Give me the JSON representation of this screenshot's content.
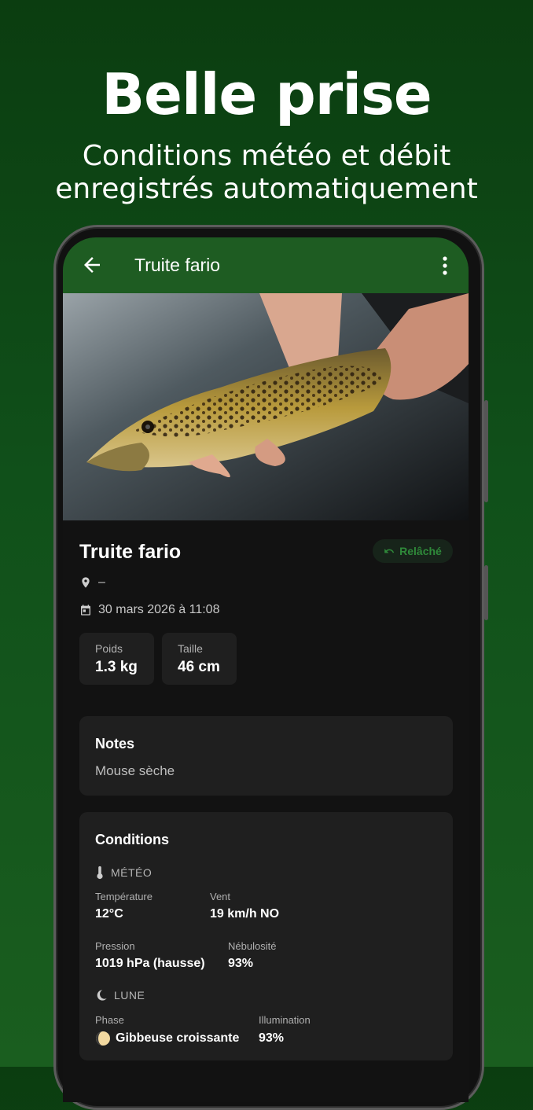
{
  "promo": {
    "title": "Belle prise",
    "subtitle_line1": "Conditions météo et débit",
    "subtitle_line2": "enregistrés automatiquement"
  },
  "appbar": {
    "title": "Truite fario",
    "back_icon": "arrow-back-icon",
    "more_icon": "more-vert-icon"
  },
  "catch": {
    "name": "Truite fario",
    "status_badge": "Relâché",
    "location": "–",
    "datetime": "30 mars 2026 à 11:08",
    "stats": [
      {
        "label": "Poids",
        "value": "1.3 kg"
      },
      {
        "label": "Taille",
        "value": "46 cm"
      }
    ]
  },
  "notes": {
    "title": "Notes",
    "text": "Mouse sèche"
  },
  "conditions": {
    "title": "Conditions",
    "weather": {
      "heading": "MÉTÉO",
      "temperature_label": "Température",
      "temperature_value": "12°C",
      "wind_label": "Vent",
      "wind_value": "19 km/h NO",
      "pressure_label": "Pression",
      "pressure_value": "1019 hPa (hausse)",
      "cloud_label": "Nébulosité",
      "cloud_value": "93%"
    },
    "moon": {
      "heading": "LUNE",
      "phase_label": "Phase",
      "phase_value": "Gibbeuse croissante",
      "illumination_label": "Illumination",
      "illumination_value": "93%"
    }
  },
  "colors": {
    "appbar": "#1e5c22",
    "background_gradient_top": "#0b3d10",
    "background_gradient_bottom": "#1a5e1f",
    "accent_green": "#2f8a3a",
    "card": "#1f1f1f",
    "screen_bg": "#121212"
  }
}
